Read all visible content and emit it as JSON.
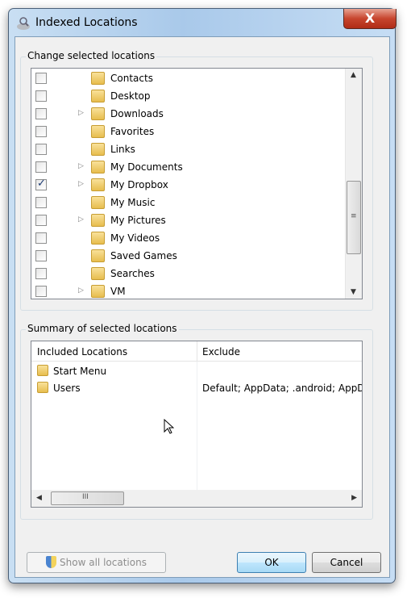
{
  "window": {
    "title": "Indexed Locations",
    "close_label": "X"
  },
  "change_group": {
    "label": "Change selected locations",
    "items": [
      {
        "label": "Contacts",
        "checked": false,
        "expandable": false
      },
      {
        "label": "Desktop",
        "checked": false,
        "expandable": false
      },
      {
        "label": "Downloads",
        "checked": false,
        "expandable": true
      },
      {
        "label": "Favorites",
        "checked": false,
        "expandable": false
      },
      {
        "label": "Links",
        "checked": false,
        "expandable": false
      },
      {
        "label": "My Documents",
        "checked": false,
        "expandable": true
      },
      {
        "label": "My Dropbox",
        "checked": true,
        "expandable": true
      },
      {
        "label": "My Music",
        "checked": false,
        "expandable": false
      },
      {
        "label": "My Pictures",
        "checked": false,
        "expandable": true
      },
      {
        "label": "My Videos",
        "checked": false,
        "expandable": false
      },
      {
        "label": "Saved Games",
        "checked": false,
        "expandable": false
      },
      {
        "label": "Searches",
        "checked": false,
        "expandable": false
      },
      {
        "label": "VM",
        "checked": false,
        "expandable": true
      }
    ]
  },
  "summary_group": {
    "label": "Summary of selected locations",
    "columns": [
      "Included Locations",
      "Exclude"
    ],
    "rows": [
      {
        "location": "Start Menu",
        "exclude": ""
      },
      {
        "location": "Users",
        "exclude": "Default; AppData; .android; AppDa"
      }
    ]
  },
  "buttons": {
    "show_all": "Show all locations",
    "ok": "OK",
    "cancel": "Cancel"
  }
}
